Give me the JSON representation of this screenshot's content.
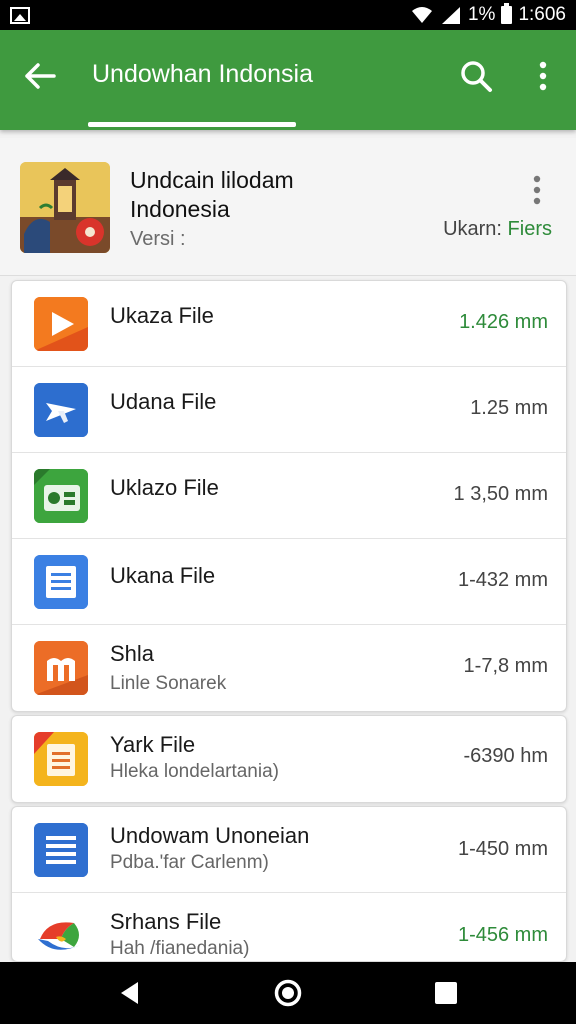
{
  "status_bar": {
    "battery": "1%",
    "time": "1:606"
  },
  "app_bar": {
    "title": "Undowhan Indonsia",
    "color": "#3f9a3f"
  },
  "app_header": {
    "name_line1": "Undcain lilodam",
    "name_line2": "Indonesia",
    "version": "Versi :",
    "meta_prefix": "Ukarn:",
    "meta_accent": "Fiers"
  },
  "files": [
    {
      "name": "Ukaza File",
      "sub": "",
      "size": "1.426 mm",
      "size_color": "green",
      "icon": "play-icon"
    },
    {
      "name": "Udana File",
      "sub": "",
      "size": "1.25 mm",
      "size_color": "dark",
      "icon": "plane-icon"
    },
    {
      "name": "Uklazo File",
      "sub": "",
      "size": "1 3,50 mm",
      "size_color": "dark",
      "icon": "radio-icon"
    },
    {
      "name": "Ukana File",
      "sub": "",
      "size": "1-432 mm",
      "size_color": "dark",
      "icon": "document-icon"
    },
    {
      "name": "Shla",
      "sub": "Linle Sonarek",
      "size": "1-7,8 mm",
      "size_color": "dark",
      "icon": "m-icon"
    },
    {
      "name": "Yark File",
      "sub": "Hleka londelartania)",
      "size": "-6390 hm",
      "size_color": "dark",
      "icon": "notes-icon"
    },
    {
      "name": "Undowam Unoneian",
      "sub": "Pdba.'far Carlenm)",
      "size": "1-450 mm",
      "size_color": "dark",
      "icon": "list-icon"
    },
    {
      "name": "Srhans File",
      "sub": "Hah /fianedania)",
      "size": "1-456 mm",
      "size_color": "green",
      "icon": "globe-icon"
    }
  ]
}
